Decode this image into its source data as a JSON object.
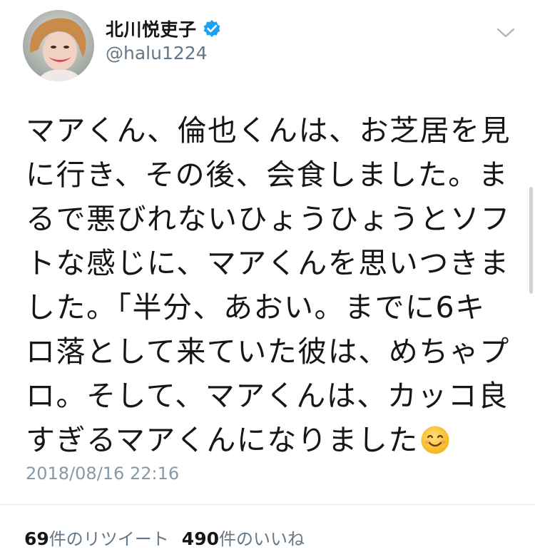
{
  "user": {
    "display_name": "北川悦吏子",
    "handle": "@halu1224",
    "verified": true
  },
  "tweet": {
    "lines": [
      "マアくん、倫也くんは、お芝居を見",
      "に行き、その後、会食しました。ま",
      "るで悪びれないひょうひょうとソフ",
      "トな感じに、マアくんを思いつきま",
      "した。「半分、あおい。までに6キ",
      "ロ落として来ていた彼は、めちゃプ",
      "ロ。そして、マアくんは、カッコ良",
      "すぎるマアくんになりました"
    ],
    "emoji": "smiling-face-icon",
    "timestamp": "2018/08/16 22:16"
  },
  "stats": {
    "retweet_count": "69",
    "retweet_label": "件のリツイート",
    "like_count": "490",
    "like_label": "件のいいね"
  },
  "colors": {
    "verified_badge": "#1da1f2",
    "secondary_text": "#657786",
    "timestamp_text": "#8899a6",
    "divider": "#e1e8ed"
  }
}
